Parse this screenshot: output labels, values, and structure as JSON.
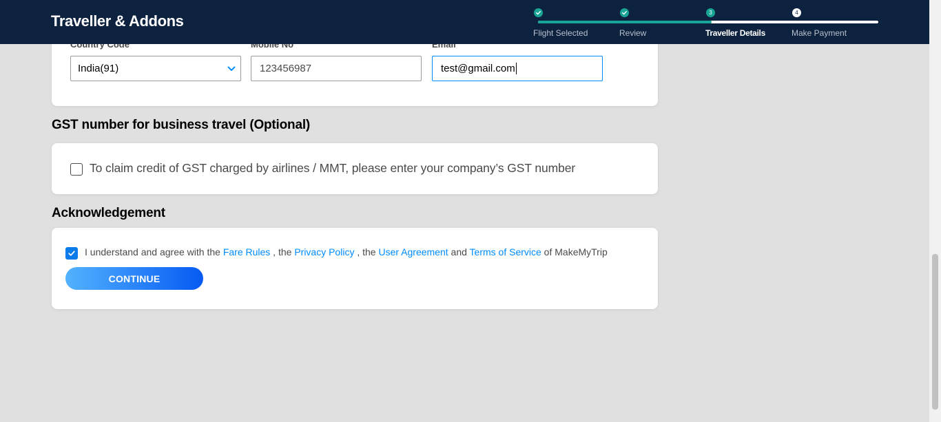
{
  "header": {
    "title": "Traveller & Addons",
    "progress_fraction": 0.51,
    "steps": [
      {
        "num": "1",
        "label": "Flight Selected",
        "state": "done"
      },
      {
        "num": "2",
        "label": "Review",
        "state": "done"
      },
      {
        "num": "3",
        "label": "Traveller Details",
        "state": "current"
      },
      {
        "num": "4",
        "label": "Make Payment",
        "state": "pending"
      }
    ]
  },
  "contact": {
    "country_code_label": "Country Code",
    "country_code_value": "India(91)",
    "mobile_label": "Mobile No",
    "mobile_value": "123456987",
    "email_label": "Email",
    "email_value": "test@gmail.com"
  },
  "gst": {
    "title": "GST number for business travel (Optional)",
    "checkbox_label": "To claim credit of GST charged by airlines / MMT, please enter your company’s GST number",
    "checked": false
  },
  "ack": {
    "title": "Acknowledgement",
    "checked": true,
    "text_1": "I understand and agree with the ",
    "link_fare_rules": "Fare Rules",
    "text_2": " , the ",
    "link_privacy": "Privacy Policy",
    "text_3": " , the ",
    "link_user_agreement": "User Agreement",
    "text_4": " and ",
    "link_terms": "Terms of Service",
    "text_5": " of MakeMyTrip",
    "continue_label": "CONTINUE"
  },
  "colors": {
    "header_bg": "#0c223f",
    "accent_teal": "#18a595",
    "link_blue": "#008cff",
    "button_gradient_start": "#53b2fe",
    "button_gradient_end": "#065af3"
  }
}
